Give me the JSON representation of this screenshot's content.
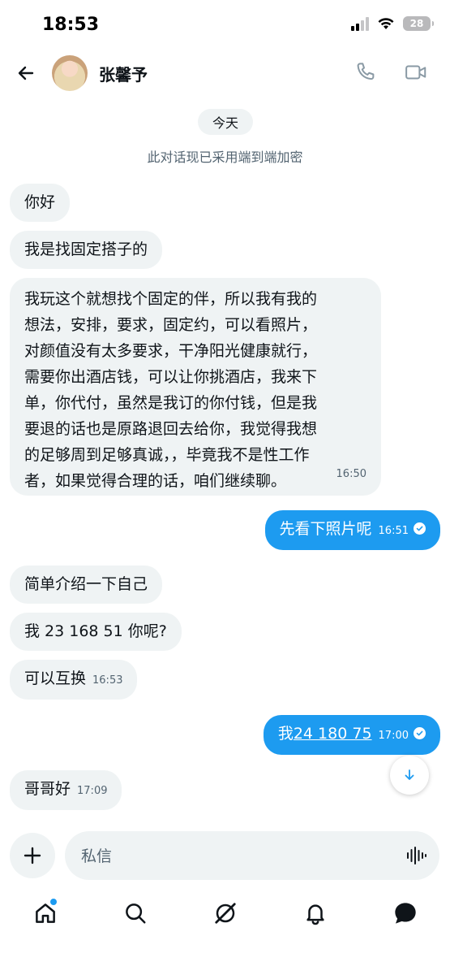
{
  "status_bar": {
    "time": "18:53",
    "battery": "28"
  },
  "header": {
    "contact_name": "张馨予"
  },
  "conversation": {
    "date_label": "今天",
    "encryption_notice": "此对话现已采用端到端加密",
    "messages": [
      {
        "dir": "in",
        "text": "你好",
        "time": ""
      },
      {
        "dir": "in",
        "text": "我是找固定搭子的",
        "time": ""
      },
      {
        "dir": "in",
        "lines": [
          "我玩这个就想找个固定的伴，所以我有我的",
          "想法，安排，要求，固定约，可以看照片，",
          "对颜值没有太多要求，干净阳光健康就行，",
          "需要你出酒店钱，可以让你挑酒店，我来下",
          "单，你代付，虽然是我订的你付钱，但是我",
          "要退的话也是原路退回去给你，我觉得我想",
          "的足够周到足够真诚，，毕竟我不是性工作",
          "者，如果觉得合理的话，咱们继续聊。"
        ],
        "time": "16:50"
      },
      {
        "dir": "out",
        "text": "先看下照片呢",
        "time": "16:51"
      },
      {
        "dir": "in",
        "text": "简单介绍一下自己",
        "time": ""
      },
      {
        "dir": "in",
        "text": "我 23 168 51 你呢?",
        "time": ""
      },
      {
        "dir": "in",
        "text": "可以互换",
        "time": "16:53"
      },
      {
        "dir": "out",
        "prefix": "我",
        "link": "24 180 75",
        "time": "17:00"
      },
      {
        "dir": "in",
        "text": "哥哥好",
        "time": "17:09"
      }
    ]
  },
  "composer": {
    "placeholder": "私信"
  },
  "nav": [
    "home-icon",
    "search-icon",
    "grok-icon",
    "notifications-icon",
    "messages-icon"
  ],
  "colors": {
    "accent": "#1d9bf0",
    "incoming_bubble": "#eff3f4",
    "muted_text": "#536471"
  }
}
